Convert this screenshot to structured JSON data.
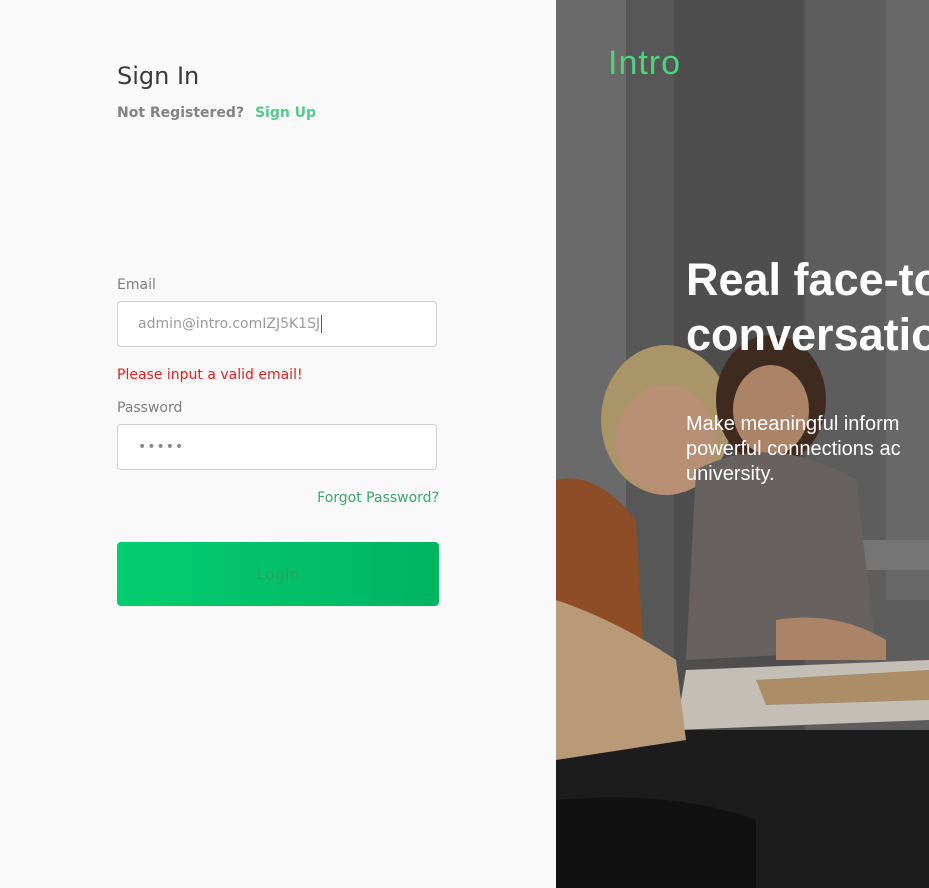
{
  "signin": {
    "title": "Sign In",
    "not_registered": "Not Registered?",
    "signup_link": "Sign Up"
  },
  "form": {
    "email_label": "Email",
    "email_value": "admin@intro.comIZJ5K1SJ",
    "email_error": "Please input a valid email!",
    "password_label": "Password",
    "password_value": "•••••",
    "forgot_link": "Forgot Password?",
    "login_button": "Login"
  },
  "hero": {
    "logo": "Intro",
    "headline_line1": "Real face-to",
    "headline_line2": "conversatio",
    "subtext_line1": "Make meaningful inform",
    "subtext_line2": "powerful connections ac",
    "subtext_line3": "university."
  },
  "colors": {
    "accent": "#00c46a",
    "link": "#54c98a",
    "error": "#e02020"
  }
}
